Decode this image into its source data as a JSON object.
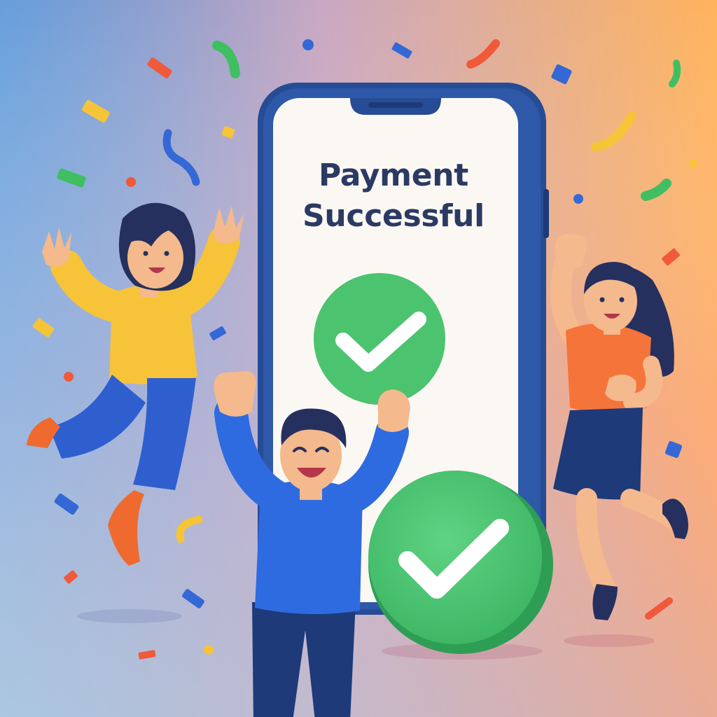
{
  "screen": {
    "title_line_1": "Payment",
    "title_line_2": "Successful"
  },
  "colors": {
    "background_left": "#5b95d8",
    "background_mid": "#c9a8c2",
    "background_right": "#ffb35c",
    "background_bottom_right": "#f98f90",
    "phone_frame": "#274c96",
    "phone_screen": "#fbf8f4",
    "title_text": "#2b3a63",
    "success_green": "#4cc36f",
    "success_green_dark": "#2f9e55",
    "checkmark": "#ffffff",
    "shirt_yellow": "#f7c338",
    "pants_blue": "#2f5fcf",
    "shirt_blue": "#2f6be0",
    "shirt_orange": "#f5743a",
    "skirt_navy": "#1e3a78",
    "shoe_orange": "#ef6a2e",
    "hair_navy": "#26305f",
    "skin": "#f4b98c"
  },
  "icons": {
    "success_check": "checkmark-circle-icon",
    "confetti": "confetti-icon"
  }
}
